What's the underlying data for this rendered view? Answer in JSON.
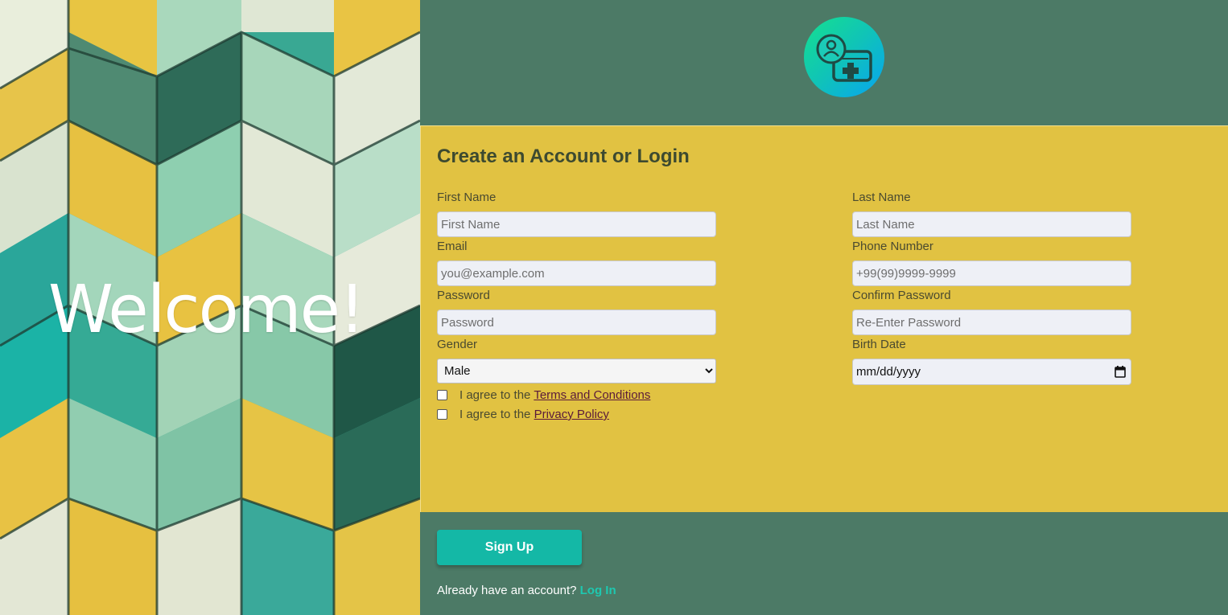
{
  "hero": {
    "welcome": "Welcome!"
  },
  "logo": {
    "icon": "user-health-card-icon"
  },
  "form": {
    "title": "Create an Account or Login",
    "first_name": {
      "label": "First Name",
      "placeholder": "First Name"
    },
    "last_name": {
      "label": "Last Name",
      "placeholder": "Last Name"
    },
    "email": {
      "label": "Email",
      "placeholder": "you@example.com"
    },
    "phone": {
      "label": "Phone Number",
      "placeholder": "+99(99)9999-9999"
    },
    "password": {
      "label": "Password",
      "placeholder": "Password"
    },
    "confirm_password": {
      "label": "Confirm Password",
      "placeholder": "Re-Enter Password"
    },
    "gender": {
      "label": "Gender",
      "selected": "Male"
    },
    "birth_date": {
      "label": "Birth Date",
      "placeholder": "mm/dd/yyyy"
    },
    "terms": {
      "prefix": "I agree to the",
      "link": "Terms and Conditions"
    },
    "privacy": {
      "prefix": "I agree to the",
      "link": "Privacy Policy"
    }
  },
  "actions": {
    "signup": "Sign Up",
    "login_prompt": "Already have an account?",
    "login_link": "Log In"
  },
  "colors": {
    "background": "#4c7a66",
    "card": "#e1c242",
    "accent": "#14b8a6"
  }
}
